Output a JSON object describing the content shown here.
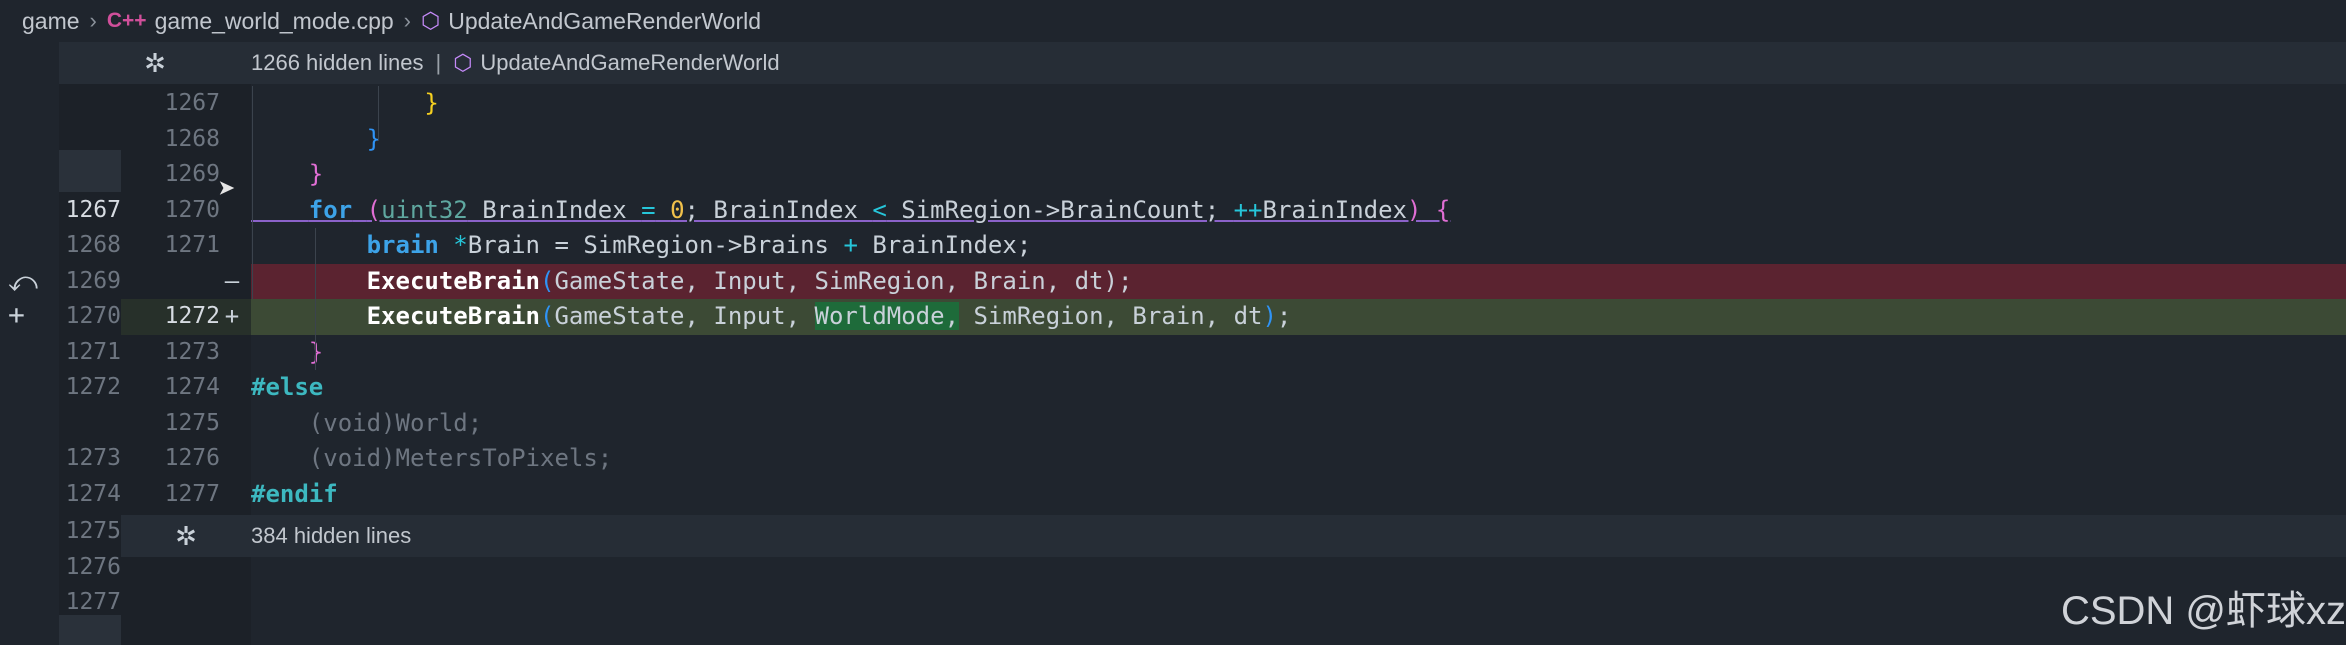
{
  "breadcrumb": {
    "folder": "game",
    "file_icon": "C++",
    "file": "game_world_mode.cpp",
    "symbol": "UpdateAndGameRenderWorld"
  },
  "hidden_top": {
    "label": "1266 hidden lines",
    "symbol": "UpdateAndGameRenderWorld"
  },
  "hidden_bottom": {
    "label": "384 hidden lines"
  },
  "rows": [
    {
      "old": "",
      "new": "1267"
    },
    {
      "old": "",
      "new": "1268"
    },
    {
      "old": "",
      "new": "1269"
    },
    {
      "old": "1267",
      "new": "1270"
    },
    {
      "old": "1268",
      "new": "1271"
    },
    {
      "old": "1269",
      "new": "",
      "marker": "—"
    },
    {
      "old": "1270",
      "new": "1272",
      "marker": "+"
    },
    {
      "old": "1271",
      "new": "1273"
    },
    {
      "old": "1272",
      "new": "1274"
    },
    {
      "old": "",
      "new": "1275"
    },
    {
      "old": "1273",
      "new": "1276"
    },
    {
      "old": "1274",
      "new": "1277"
    }
  ],
  "after_rows": [
    "1275",
    "1276",
    "1277"
  ],
  "code": {
    "close_yellow": "}",
    "close_blue": "}",
    "close_purple": "}",
    "for_kw": "for",
    "for_open": "(",
    "for_type": "uint32",
    "for_var": " BrainIndex ",
    "for_eq": "=",
    "for_zero": "0",
    "for_semi": "; BrainIndex ",
    "for_lt": "<",
    "for_cond": " SimRegion->BrainCount; ",
    "for_inc": "++",
    "for_var2": "BrainIndex",
    "for_close": ")",
    "for_brace": " {",
    "brain_kw": "brain",
    "brain_star": " *",
    "brain_rest": "Brain = SimRegion->Brains ",
    "brain_plus": "+",
    "brain_end": " BrainIndex;",
    "exec_fn": "ExecuteBrain",
    "exec_open": "(",
    "del_args": "GameState, Input, SimRegion, Brain, dt);",
    "add_args1": "GameState, Input, ",
    "add_world": "WorldMode,",
    "add_args2": " SimRegion, Brain, dt",
    "add_close": ")",
    "add_semi": ";",
    "close_for": "}",
    "else_dir": "#else",
    "void_open": "(",
    "void_kw": "void",
    "void_close": ")",
    "void_world": "World;",
    "void_meters": "MetersToPixels;",
    "endif_dir": "#endif"
  },
  "icons": {
    "unfold": "unfold-icon",
    "revert": "revert-icon",
    "add": "add-icon",
    "pointer": "mouse-pointer-icon"
  },
  "watermark": "CSDN @虾球xz"
}
